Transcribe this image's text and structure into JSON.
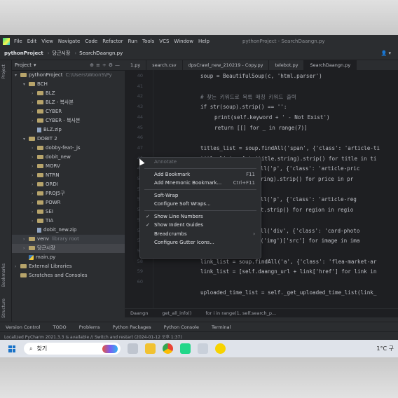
{
  "app": {
    "menu": [
      "File",
      "Edit",
      "View",
      "Navigate",
      "Code",
      "Refactor",
      "Run",
      "Tools",
      "VCS",
      "Window",
      "Help"
    ],
    "window_title": "pythonProject - SearchDaangn.py"
  },
  "nav": {
    "project": "pythonProject",
    "folder": "당근시장",
    "file": "SearchDaangn.py"
  },
  "project_panel": {
    "header": "Project",
    "rows": [
      {
        "label": "pythonProject",
        "extra": "C:\\Users\\WoonS\\Py",
        "indent": 0,
        "kind": "folder",
        "arrow": "▾"
      },
      {
        "label": "BCH",
        "indent": 1,
        "kind": "folder",
        "arrow": "▾"
      },
      {
        "label": "BLZ",
        "indent": 2,
        "kind": "folder",
        "arrow": "›"
      },
      {
        "label": "BLZ - 복사본",
        "indent": 2,
        "kind": "folder",
        "arrow": "›"
      },
      {
        "label": "CYBER",
        "indent": 2,
        "kind": "folder",
        "arrow": "›"
      },
      {
        "label": "CYBER - 복사본",
        "indent": 2,
        "kind": "folder",
        "arrow": "›"
      },
      {
        "label": "BLZ.zip",
        "indent": 2,
        "kind": "file",
        "arrow": ""
      },
      {
        "label": "DOBIT 2",
        "indent": 1,
        "kind": "folder",
        "arrow": "▾"
      },
      {
        "label": "dobby-feat-_js",
        "indent": 2,
        "kind": "folder",
        "arrow": "›"
      },
      {
        "label": "dobit_new",
        "indent": 2,
        "kind": "folder",
        "arrow": "›"
      },
      {
        "label": "MORV",
        "indent": 2,
        "kind": "folder",
        "arrow": "›"
      },
      {
        "label": "NTRN",
        "indent": 2,
        "kind": "folder",
        "arrow": "›"
      },
      {
        "label": "ORDI",
        "indent": 2,
        "kind": "folder",
        "arrow": "›"
      },
      {
        "label": "PROJ5구",
        "indent": 2,
        "kind": "folder",
        "arrow": "›"
      },
      {
        "label": "POWR",
        "indent": 2,
        "kind": "folder",
        "arrow": "›"
      },
      {
        "label": "SEI",
        "indent": 2,
        "kind": "folder",
        "arrow": "›"
      },
      {
        "label": "TIA",
        "indent": 2,
        "kind": "folder",
        "arrow": "›"
      },
      {
        "label": "dobit_new.zip",
        "indent": 2,
        "kind": "file",
        "arrow": ""
      },
      {
        "label": "venv",
        "extra": "library root",
        "indent": 1,
        "kind": "folder",
        "arrow": "›"
      },
      {
        "label": "당근시장",
        "indent": 1,
        "kind": "folder",
        "arrow": "›"
      },
      {
        "label": "main.py",
        "indent": 1,
        "kind": "py",
        "arrow": ""
      },
      {
        "label": "External Libraries",
        "indent": 0,
        "kind": "folder",
        "arrow": "›"
      },
      {
        "label": "Scratches and Consoles",
        "indent": 0,
        "kind": "folder",
        "arrow": ""
      }
    ]
  },
  "tabs": [
    "1.py",
    "search.csv",
    "dpsCrawl_new_210219 - Copy.py",
    "telebot.py",
    "SearchDaangn.py"
  ],
  "gutter_lines": [
    "40",
    "41",
    "42",
    "43",
    "44",
    "45",
    "46",
    "47",
    "48",
    "49",
    "50",
    "51",
    "52",
    "53",
    "54",
    "55",
    "56",
    "57",
    "58",
    "59",
    "60"
  ],
  "code": [
    {
      "t": "soup = BeautifulSoup(c, 'html.parser')",
      "i": 0
    },
    {
      "t": "",
      "i": 0
    },
    {
      "t": "# 찾는 키워드로 목록 매칭 키워드 출력",
      "i": 0,
      "c": "cm"
    },
    {
      "t": "if str(soup).strip() == '':",
      "i": 0
    },
    {
      "t": "print(self.keyword + ' - Not Exist')",
      "i": 1
    },
    {
      "t": "return [[] for _ in range(7)]",
      "i": 1
    },
    {
      "t": "",
      "i": 0
    },
    {
      "t": "titles_list = soup.findAll('span', {'class': 'article-ti",
      "i": 0
    },
    {
      "t": "title_list = [str(title.string).strip() for title in ti",
      "i": 0
    },
    {
      "t": "soup.findAll('p', {'class': 'article-pric",
      "i": 2
    },
    {
      "t": "r(price.string).strip() for price in pr",
      "i": 2
    },
    {
      "t": "",
      "i": 0
    },
    {
      "t": "soup.findAll('p', {'class': 'article-reg",
      "i": 2
    },
    {
      "t": "region.text.strip() for region in regio",
      "i": 2
    },
    {
      "t": "",
      "i": 0
    },
    {
      "t": "soup.findAll('div', {'class': 'card-photo",
      "i": 2
    },
    {
      "t": "image.find('img')['src'] for image in ima",
      "i": 2
    },
    {
      "t": "",
      "i": 0
    },
    {
      "t": "link_list = soup.findAll('a', {'class': 'flea-market-ar",
      "i": 0
    },
    {
      "t": "link_list = [self.daangn_url + link['href'] for link in",
      "i": 0
    },
    {
      "t": "",
      "i": 0
    },
    {
      "t": "uploaded_time_list = self._get_uploaded_time_list(link_",
      "i": 0
    }
  ],
  "breadcrumbs": [
    "Daangn",
    "get_all_info()",
    "for i in range(1, self.search_p..."
  ],
  "tool_windows": [
    "Version Control",
    "TODO",
    "Problems",
    "Python Packages",
    "Python Console",
    "Terminal"
  ],
  "status_text": "Localized PyCharm 2021.3.3 is available // Switch and restart (2024-01-12 오후 1:37)",
  "context_menu": [
    {
      "label": "Annotate",
      "shortcut": "",
      "disabled": true
    },
    {
      "sep": true
    },
    {
      "label": "Add Bookmark",
      "shortcut": "F11"
    },
    {
      "label": "Add Mnemonic Bookmark...",
      "shortcut": "Ctrl+F11"
    },
    {
      "sep": true
    },
    {
      "label": "Soft-Wrap",
      "shortcut": ""
    },
    {
      "label": "Configure Soft Wraps...",
      "shortcut": ""
    },
    {
      "sep": true
    },
    {
      "label": "Show Line Numbers",
      "shortcut": "",
      "checked": true
    },
    {
      "label": "Show Indent Guides",
      "shortcut": "",
      "checked": true
    },
    {
      "label": "Breadcrumbs",
      "shortcut": "›"
    },
    {
      "label": "Configure Gutter Icons...",
      "shortcut": ""
    }
  ],
  "taskbar": {
    "search": "찾기",
    "tray": "1°C 구"
  },
  "side_labels": {
    "project": "Project",
    "bookmarks": "Bookmarks",
    "structure": "Structure"
  }
}
